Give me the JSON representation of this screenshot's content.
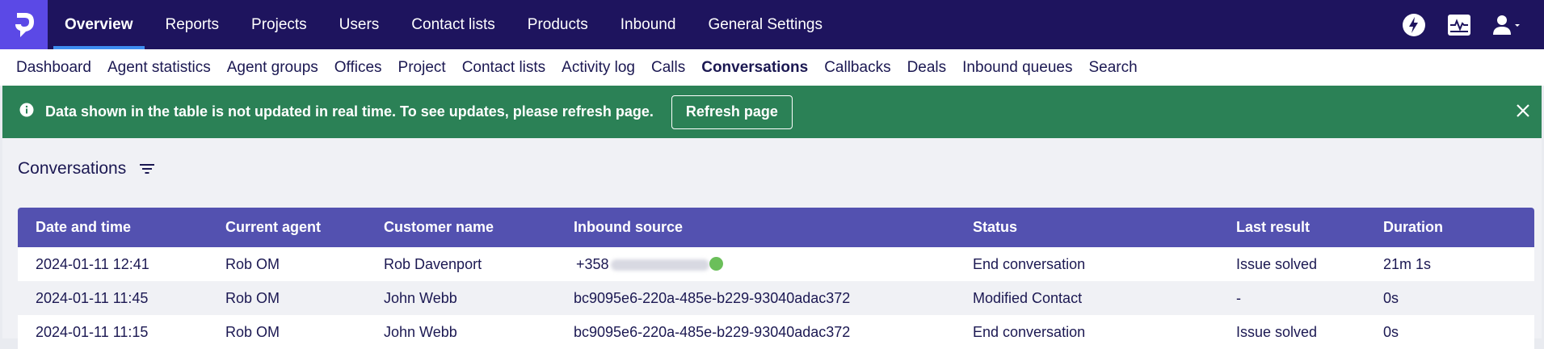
{
  "top_nav": {
    "items": [
      "Overview",
      "Reports",
      "Projects",
      "Users",
      "Contact lists",
      "Products",
      "Inbound",
      "General Settings"
    ],
    "active": "Overview"
  },
  "top_icons": [
    "lightning-icon",
    "activity-monitor-icon",
    "user-menu-icon"
  ],
  "sub_nav": {
    "items": [
      "Dashboard",
      "Agent statistics",
      "Agent groups",
      "Offices",
      "Project",
      "Contact lists",
      "Activity log",
      "Calls",
      "Conversations",
      "Callbacks",
      "Deals",
      "Inbound queues",
      "Search"
    ],
    "active": "Conversations"
  },
  "banner": {
    "message": "Data shown in the table is not updated in real time. To see updates, please refresh page.",
    "button": "Refresh page",
    "color": "#2b8156"
  },
  "section": {
    "title": "Conversations"
  },
  "table": {
    "headers": [
      "Date and time",
      "Current agent",
      "Customer name",
      "Inbound source",
      "Status",
      "Last result",
      "Duration"
    ],
    "rows": [
      {
        "date": "2024-01-11 12:41",
        "agent": "Rob OM",
        "customer": "Rob Davenport",
        "source": "+358",
        "status": "End conversation",
        "result": "Issue solved",
        "duration": "21m 1s"
      },
      {
        "date": "2024-01-11 11:45",
        "agent": "Rob OM",
        "customer": "John Webb",
        "source": "bc9095e6-220a-485e-b229-93040adac372",
        "status": "Modified Contact",
        "result": "-",
        "duration": "0s"
      },
      {
        "date": "2024-01-11 11:15",
        "agent": "Rob OM",
        "customer": "John Webb",
        "source": "bc9095e6-220a-485e-b229-93040adac372",
        "status": "End conversation",
        "result": "Issue solved",
        "duration": "0s"
      }
    ]
  },
  "colors": {
    "topbar": "#1e145e",
    "logo": "#5b49e6",
    "table_header": "#5351b0",
    "active_tab_underline": "#3e8df0"
  }
}
